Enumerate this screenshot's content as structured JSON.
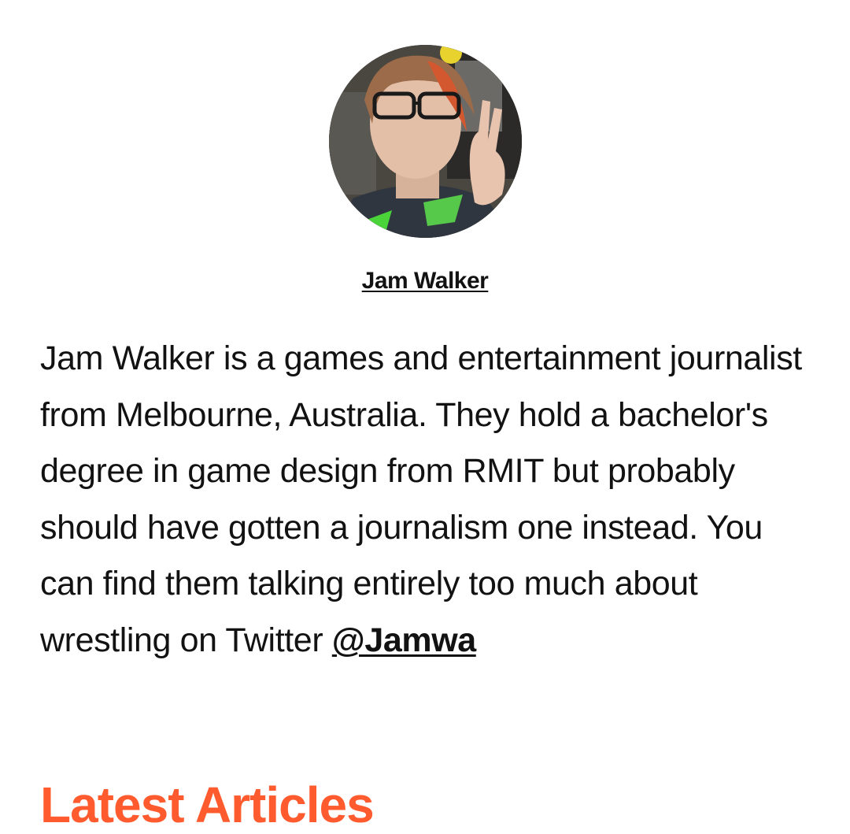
{
  "author": {
    "name": "Jam Walker",
    "bio_text": "Jam Walker is a games and entertainment journalist from Melbourne, Australia. They hold a bachelor's degree in game design from RMIT but probably should have gotten a journalism one instead. You can find them talking entirely too much about wrestling on Twitter ",
    "twitter_handle": "@Jamwa",
    "avatar_icon": "author-photo"
  },
  "latest": {
    "heading": "Latest Articles"
  },
  "colors": {
    "accent": "#ff5b2e",
    "text": "#121212",
    "background": "#ffffff"
  }
}
